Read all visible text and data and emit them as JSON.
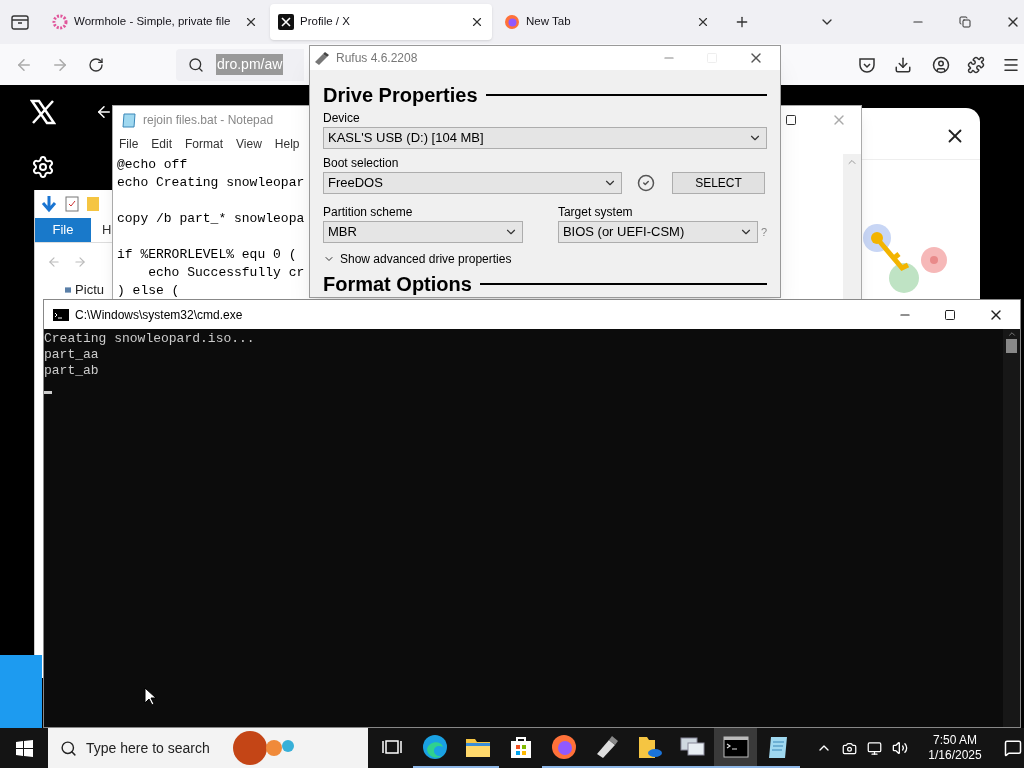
{
  "browser": {
    "tabs": [
      {
        "title": "Wormhole - Simple, private file",
        "selected": false
      },
      {
        "title": "Profile / X",
        "selected": true
      },
      {
        "title": "New Tab",
        "selected": false
      }
    ],
    "address": "dro.pm/aw"
  },
  "explorer": {
    "ribbon_tabs": [
      {
        "label": "File",
        "selected": true
      },
      {
        "label": "H",
        "selected": false
      }
    ],
    "nav_item": "Pictu"
  },
  "notepad": {
    "title": "rejoin files.bat - Notepad",
    "menu": [
      "File",
      "Edit",
      "Format",
      "View",
      "Help"
    ],
    "blocks": [
      [
        "@echo off",
        "echo Creating snowleopar"
      ],
      [
        "copy /b part_* snowleopa"
      ],
      [
        "if %ERRORLEVEL% equ 0 (",
        "    echo Successfully cr",
        ") else ("
      ]
    ]
  },
  "rufus": {
    "title": "Rufus 4.6.2208",
    "section": "Drive Properties",
    "device_label": "Device",
    "device": "KASL'S USB (D:) [104 MB]",
    "boot_label": "Boot selection",
    "boot": "FreeDOS",
    "select_button": "SELECT",
    "partition_label": "Partition scheme",
    "partition": "MBR",
    "target_label": "Target system",
    "target": "BIOS (or UEFI-CSM)",
    "help": "?",
    "advanced": "Show advanced drive properties",
    "next_section": "Format Options"
  },
  "cmd": {
    "title": "C:\\Windows\\system32\\cmd.exe",
    "lines": [
      "Creating snowleopard.iso...",
      "part_aa",
      "part_ab"
    ]
  },
  "taskbar": {
    "search_placeholder": "Type here to search",
    "apps": [
      {
        "kind": "taskview",
        "open": false,
        "selected": false
      },
      {
        "kind": "edge",
        "open": true,
        "selected": false
      },
      {
        "kind": "explorer",
        "open": true,
        "selected": false
      },
      {
        "kind": "store",
        "open": false,
        "selected": false
      },
      {
        "kind": "firefox",
        "open": true,
        "selected": false
      },
      {
        "kind": "usb",
        "open": true,
        "selected": false
      },
      {
        "kind": "onedrive",
        "open": true,
        "selected": false
      },
      {
        "kind": "remote",
        "open": true,
        "selected": false
      },
      {
        "kind": "cmd",
        "open": true,
        "selected": true
      },
      {
        "kind": "notepad",
        "open": true,
        "selected": false
      }
    ],
    "time": "7:50 AM",
    "date": "1/16/2025"
  }
}
